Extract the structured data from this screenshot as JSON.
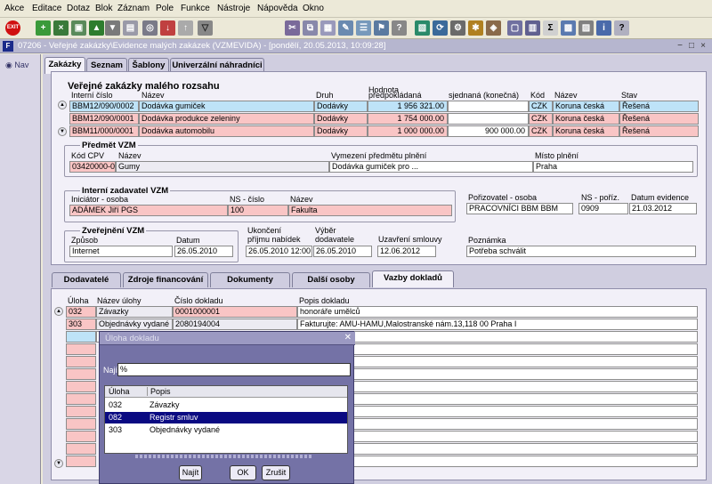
{
  "menu": [
    "Akce",
    "Editace",
    "Dotaz",
    "Blok",
    "Záznam",
    "Pole",
    "Funkce",
    "Nástroje",
    "Nápověda",
    "Okno"
  ],
  "window": {
    "title": "07206 - Veřejné zakázky\\Evidence malých zakázek (VZMEVIDA) - [pondělí, 20.05.2013, 10:09:28]"
  },
  "nav": {
    "label": "Nav"
  },
  "tabs": [
    "Zakázky",
    "Seznam",
    "Šablony",
    "Univerzální náhradníci"
  ],
  "section_title": "Veřejné zakázky malého rozsahu",
  "grid": {
    "headers": {
      "interni": "Interní číslo",
      "nazev": "Název",
      "druh": "Druh",
      "hodnota": "Hodnota",
      "predpokladana": "předpokládaná",
      "sjednana": "sjednaná (konečná)",
      "kod": "Kód",
      "mena": "Název",
      "stav": "Stav"
    },
    "rows": [
      {
        "interni": "BBM12/090/0002",
        "nazev": "Dodávka gumiček",
        "druh": "Dodávky",
        "predpokladana": "1 956 321.00",
        "sjednana": "",
        "kod": "CZK",
        "mena": "Koruna česká",
        "stav": "Řešená"
      },
      {
        "interni": "BBM12/090/0001",
        "nazev": "Dodávka produkce zeleniny",
        "druh": "Dodávky",
        "predpokladana": "1 754 000.00",
        "sjednana": "",
        "kod": "CZK",
        "mena": "Koruna česká",
        "stav": "Řešená"
      },
      {
        "interni": "BBM11/000/0001",
        "nazev": "Dodávka automobilu",
        "druh": "Dodávky",
        "predpokladana": "1 000 000.00",
        "sjednana": "900 000.00",
        "kod": "CZK",
        "mena": "Koruna česká",
        "stav": "Řešená"
      }
    ]
  },
  "predmet": {
    "title": "Předmět VZM",
    "kod_cpv_label": "Kód CPV",
    "kod_cpv": "03420000-0",
    "nazev_label": "Název",
    "nazev": "Gumy",
    "vymezeni_label": "Vymezení předmětu plnění",
    "vymezeni": "Dodávka gumiček pro ...",
    "misto_label": "Místo plnění",
    "misto": "Praha"
  },
  "zadavatel": {
    "title": "Interní zadavatel VZM",
    "iniciator_label": "Iniciátor - osoba",
    "iniciator": "ADÁMEK Jiří PGS",
    "ns_label": "NS - číslo",
    "ns": "100",
    "nazev_label": "Název",
    "nazev": "Fakulta"
  },
  "porizovatel": {
    "osoba_label": "Pořizovatel - osoba",
    "osoba": "PRACOVNÍCI BBM BBM",
    "ns_label": "NS - poříz.",
    "ns": "0909",
    "datum_label": "Datum evidence",
    "datum": "21.03.2012"
  },
  "zverejneni": {
    "title": "Zveřejnění VZM",
    "zpusob_label": "Způsob",
    "zpusob": "Internet",
    "datum_label": "Datum",
    "datum": "26.05.2010",
    "ukonceni_label1": "Ukončení",
    "ukonceni_label2": "příjmu nabídek",
    "ukonceni": "26.05.2010 12:00",
    "vyber_label1": "Výběr",
    "vyber_label2": "dodavatele",
    "vyber": "26.05.2010",
    "uzavreni_label": "Uzavření smlouvy",
    "uzavreni": "12.06.2012",
    "poznamka_label": "Poznámka",
    "poznamka": "Potřeba schválit"
  },
  "bottom_tabs": [
    "Dodavatelé",
    "Zdroje financování",
    "Dokumenty",
    "Další osoby",
    "Vazby dokladů"
  ],
  "vazby": {
    "headers": {
      "uloha": "Úloha",
      "nazev": "Název úlohy",
      "cislo": "Číslo dokladu",
      "popis": "Popis dokladu"
    },
    "rows": [
      {
        "uloha": "032",
        "nazev": "Závazky",
        "cislo": "0001000001",
        "popis": "honoráře umělců"
      },
      {
        "uloha": "303",
        "nazev": "Objednávky vydané",
        "cislo": "2080194004",
        "popis": "Fakturujte:  AMU-HAMU,Malostranské nám.13,118 00 Praha I"
      }
    ]
  },
  "dialog": {
    "title": "Úloha dokladu",
    "find_label": "Najít",
    "find_value": "%",
    "col_uloha": "Úloha",
    "col_popis": "Popis",
    "items": [
      {
        "uloha": "032",
        "popis": "Závazky"
      },
      {
        "uloha": "082",
        "popis": "Registr smluv"
      },
      {
        "uloha": "303",
        "popis": "Objednávky vydané"
      }
    ],
    "btn_find": "Najít",
    "btn_ok": "OK",
    "btn_cancel": "Zrušit"
  }
}
